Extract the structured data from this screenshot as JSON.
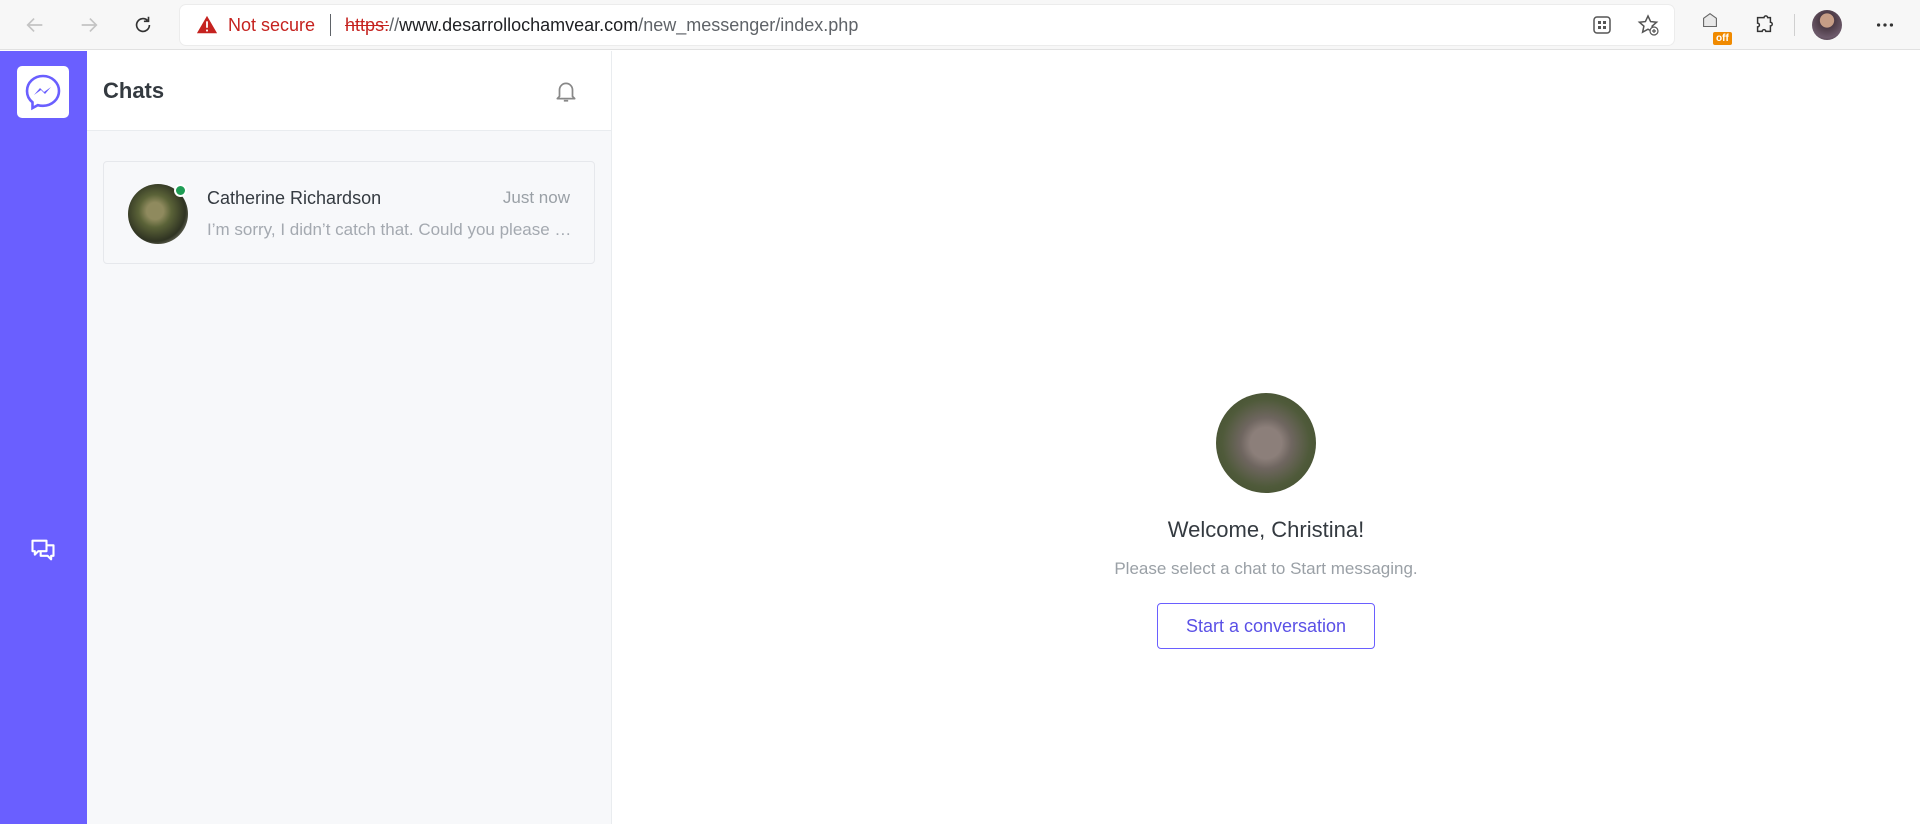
{
  "browser": {
    "security_label": "Not secure",
    "url_protocol": "https:",
    "url_slashes": "//",
    "url_host": "www.desarrollochamvear.com",
    "url_path": "/new_messenger/index.php",
    "extension_badge": "off",
    "icons": [
      "back-icon",
      "forward-icon",
      "reload-icon",
      "warning-icon",
      "app-grid-icon",
      "favorite-add-icon",
      "extension-icon",
      "puzzle-icon",
      "more-icon"
    ]
  },
  "rail": {
    "icons": [
      "messenger-logo-icon",
      "chat-bubbles-icon"
    ],
    "accent": "#6a5fff"
  },
  "sidebar": {
    "title": "Chats",
    "chats": [
      {
        "name": "Catherine Richardson",
        "time": "Just now",
        "preview": "I’m sorry, I didn’t catch that. Could you please repeat?",
        "online": true,
        "status_color": "#1f9d55"
      }
    ]
  },
  "main": {
    "welcome_title": "Welcome, Christina!",
    "welcome_subtitle": "Please select a chat to Start messaging.",
    "start_button": "Start a conversation"
  }
}
